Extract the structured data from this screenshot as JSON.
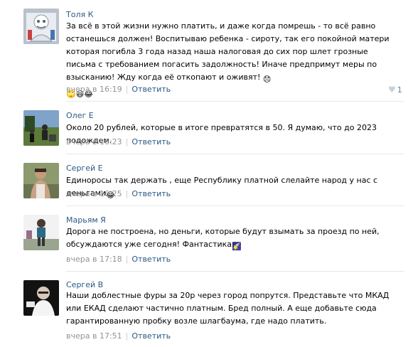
{
  "comments": [
    {
      "author": "Толя К",
      "text": "За всё в этой жизни нужно платить, и даже когда помрешь - то всё равно останешься должен! Воспитываю ребенка - сироту, так его покойной матери которая погибла 3 года назад наша налоговая до сих пор шлет грозные письма с требованием погасить задолжность! Иначе предпримут меры по взысканию! Жду когда её откопают и оживят!",
      "emojis": [
        "😞",
        "🙄",
        "😆",
        "😂"
      ],
      "date": "вчера в 16:19",
      "reply": "Ответить",
      "likes": "1"
    },
    {
      "author": "Олег Е",
      "text": "Около 20 рублей, которые в итоге превратятся в 50. Я думаю, что до 2023 подождем.",
      "date": "вчера в 16:23",
      "reply": "Ответить"
    },
    {
      "author": "Сергей Е",
      "text": "Единоросы так держать , еще Республику платной слелайте народ у нас с деньгами",
      "emoji": "😂",
      "date": "вчера в 16:25",
      "reply": "Ответить"
    },
    {
      "author": "Марьям Я",
      "text": "Дорога не построена, но деньги, которые будут взымать за проезд по ней, обсуждаются уже сегодня! Фантастика",
      "emoji": "🌠",
      "date": "вчера в 17:18",
      "reply": "Ответить"
    },
    {
      "author": "Сергей В",
      "text": "Наши доблестные фуры за 20р через город попрутся. Представьте что МКАД или ЕКАД сделают частично платным. Бред полный. А еще добавьте сюда гарантированную пробку возле шлагбаума, где надо платить.",
      "date": "вчера в 17:51",
      "reply": "Ответить"
    }
  ]
}
